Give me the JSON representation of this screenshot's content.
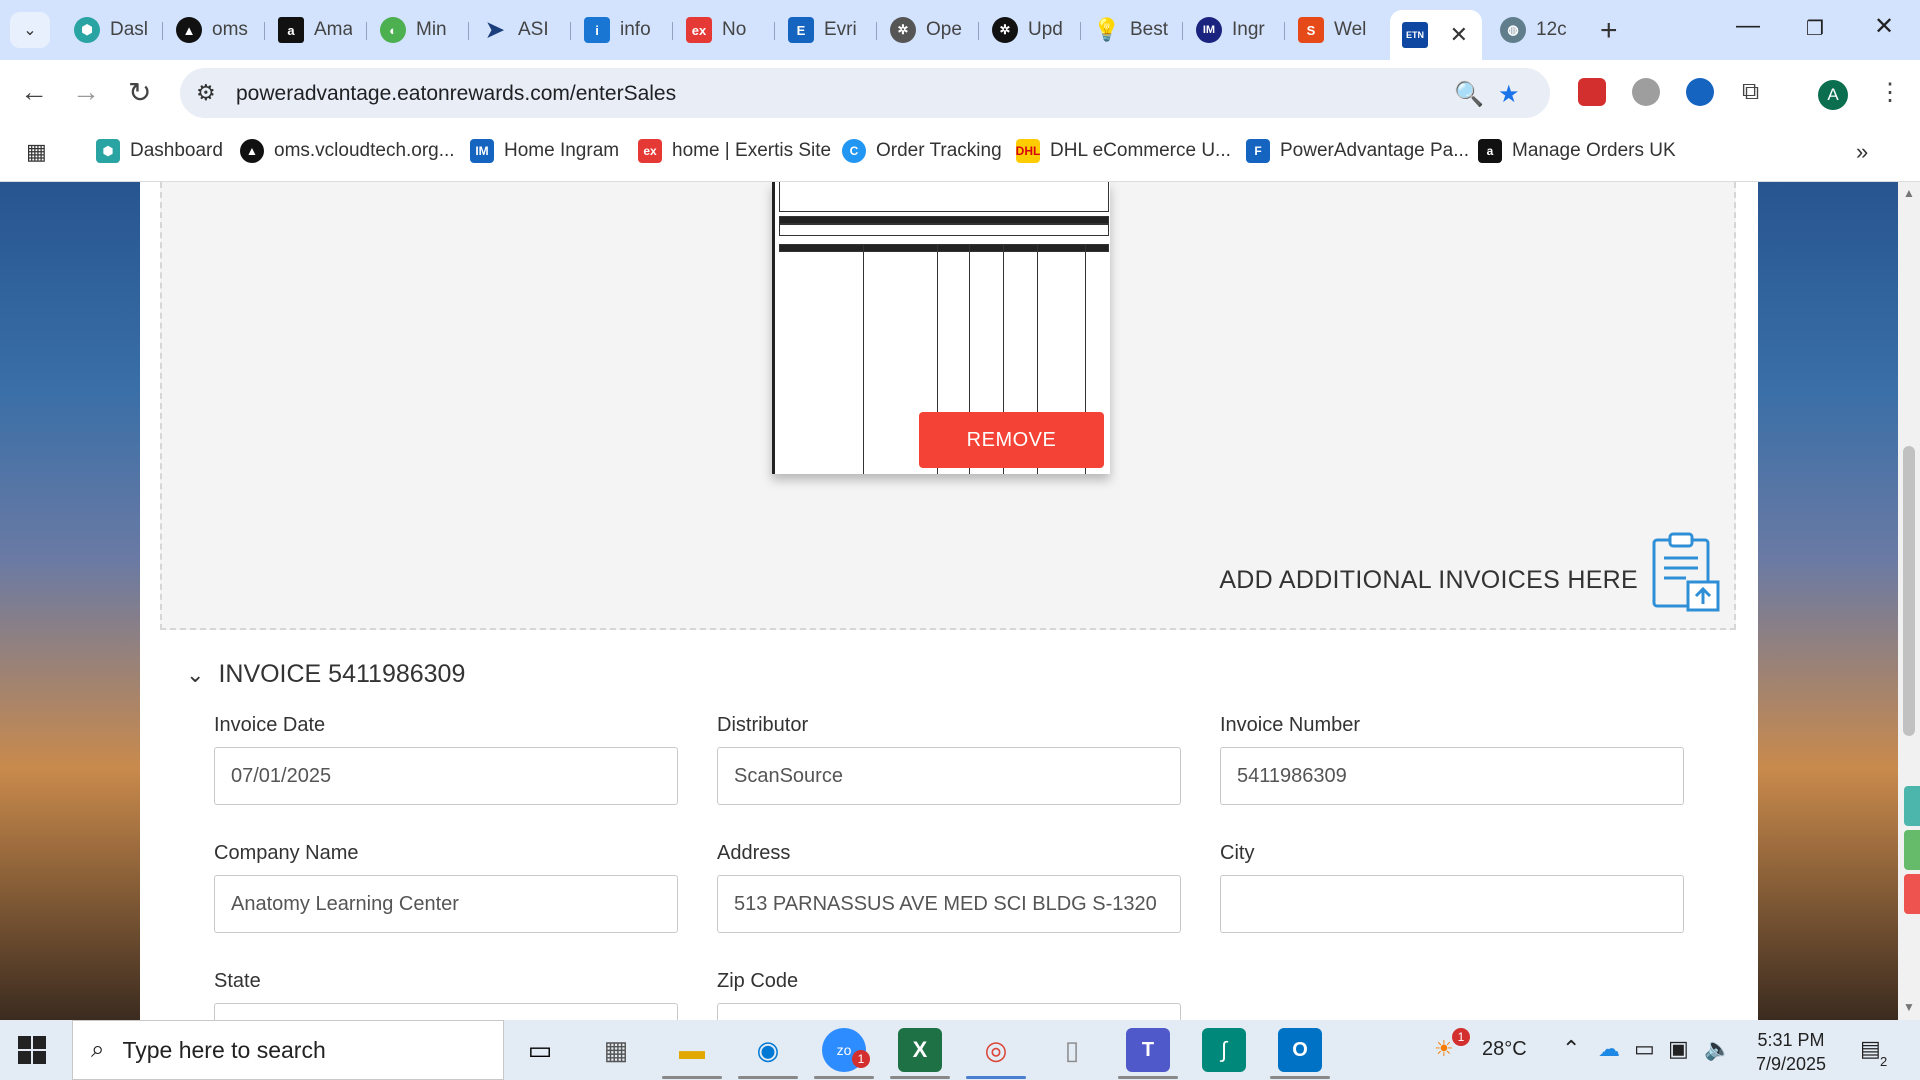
{
  "tabs": [
    {
      "label": "Dasl",
      "icon": "dashboard-hex-icon",
      "color": "#2aa3a3"
    },
    {
      "label": "oms",
      "icon": "oms-triangle-icon",
      "color": "#111111"
    },
    {
      "label": "Ama",
      "icon": "amazon-icon",
      "color": "#111111"
    },
    {
      "label": "Min",
      "icon": "mint-icon",
      "color": "#4caf50"
    },
    {
      "label": "ASI",
      "icon": "asi-arrow-icon",
      "color": "#1a3d7c"
    },
    {
      "label": "info",
      "icon": "info-icon",
      "color": "#1976d2"
    },
    {
      "label": "No",
      "icon": "exertis-icon",
      "color": "#e53935"
    },
    {
      "label": "Evri",
      "icon": "evri-icon",
      "color": "#1565c0"
    },
    {
      "label": "Ope",
      "icon": "openai-icon",
      "color": "#333333"
    },
    {
      "label": "Upd",
      "icon": "openai-icon",
      "color": "#111111"
    },
    {
      "label": "Best",
      "icon": "bulb-icon",
      "color": "#e65100"
    },
    {
      "label": "Ingr",
      "icon": "ingram-icon",
      "color": "#1a237e"
    },
    {
      "label": "Wel",
      "icon": "wel-icon",
      "color": "#e64a19"
    },
    {
      "label": "",
      "icon": "eaton-icon",
      "color": "#0d47a1"
    },
    {
      "label": "12c",
      "icon": "globe-icon",
      "color": "#607d8b"
    }
  ],
  "url": "poweradvantage.eatonrewards.com/enterSales",
  "bookmarks": [
    {
      "label": "Dashboard",
      "color": "#2aa3a3"
    },
    {
      "label": "oms.vcloudtech.org...",
      "color": "#111111"
    },
    {
      "label": "Home Ingram",
      "color": "#1565c0"
    },
    {
      "label": "home | Exertis Site",
      "color": "#e53935"
    },
    {
      "label": "Order Tracking",
      "color": "#2196f3"
    },
    {
      "label": "DHL eCommerce U...",
      "color": "#ffcc00"
    },
    {
      "label": "PowerAdvantage Pa...",
      "color": "#1565c0"
    },
    {
      "label": "Manage Orders UK",
      "color": "#111111"
    }
  ],
  "upload": {
    "remove_label": "REMOVE",
    "add_label": "ADD ADDITIONAL INVOICES HERE"
  },
  "invoice": {
    "title": "INVOICE 5411986309",
    "fields": {
      "invoice_date": {
        "label": "Invoice Date",
        "value": "07/01/2025"
      },
      "distributor": {
        "label": "Distributor",
        "value": "ScanSource"
      },
      "invoice_number": {
        "label": "Invoice Number",
        "value": "5411986309"
      },
      "company_name": {
        "label": "Company Name",
        "value": "Anatomy Learning Center"
      },
      "address": {
        "label": "Address",
        "value": "513 PARNASSUS AVE MED SCI BLDG S-1320"
      },
      "city": {
        "label": "City",
        "value": ""
      },
      "state": {
        "label": "State",
        "value": ""
      },
      "zip": {
        "label": "Zip Code",
        "value": ""
      }
    }
  },
  "taskbar": {
    "search_placeholder": "Type here to search",
    "weather": "28°C",
    "weather_badge": "1",
    "time": "5:31 PM",
    "date": "7/9/2025",
    "notif_count": "2",
    "zoom_badge": "1"
  },
  "colors": {
    "accent": "#f44336",
    "tabstrip": "#d3e3fd",
    "star": "#1a73e8"
  }
}
